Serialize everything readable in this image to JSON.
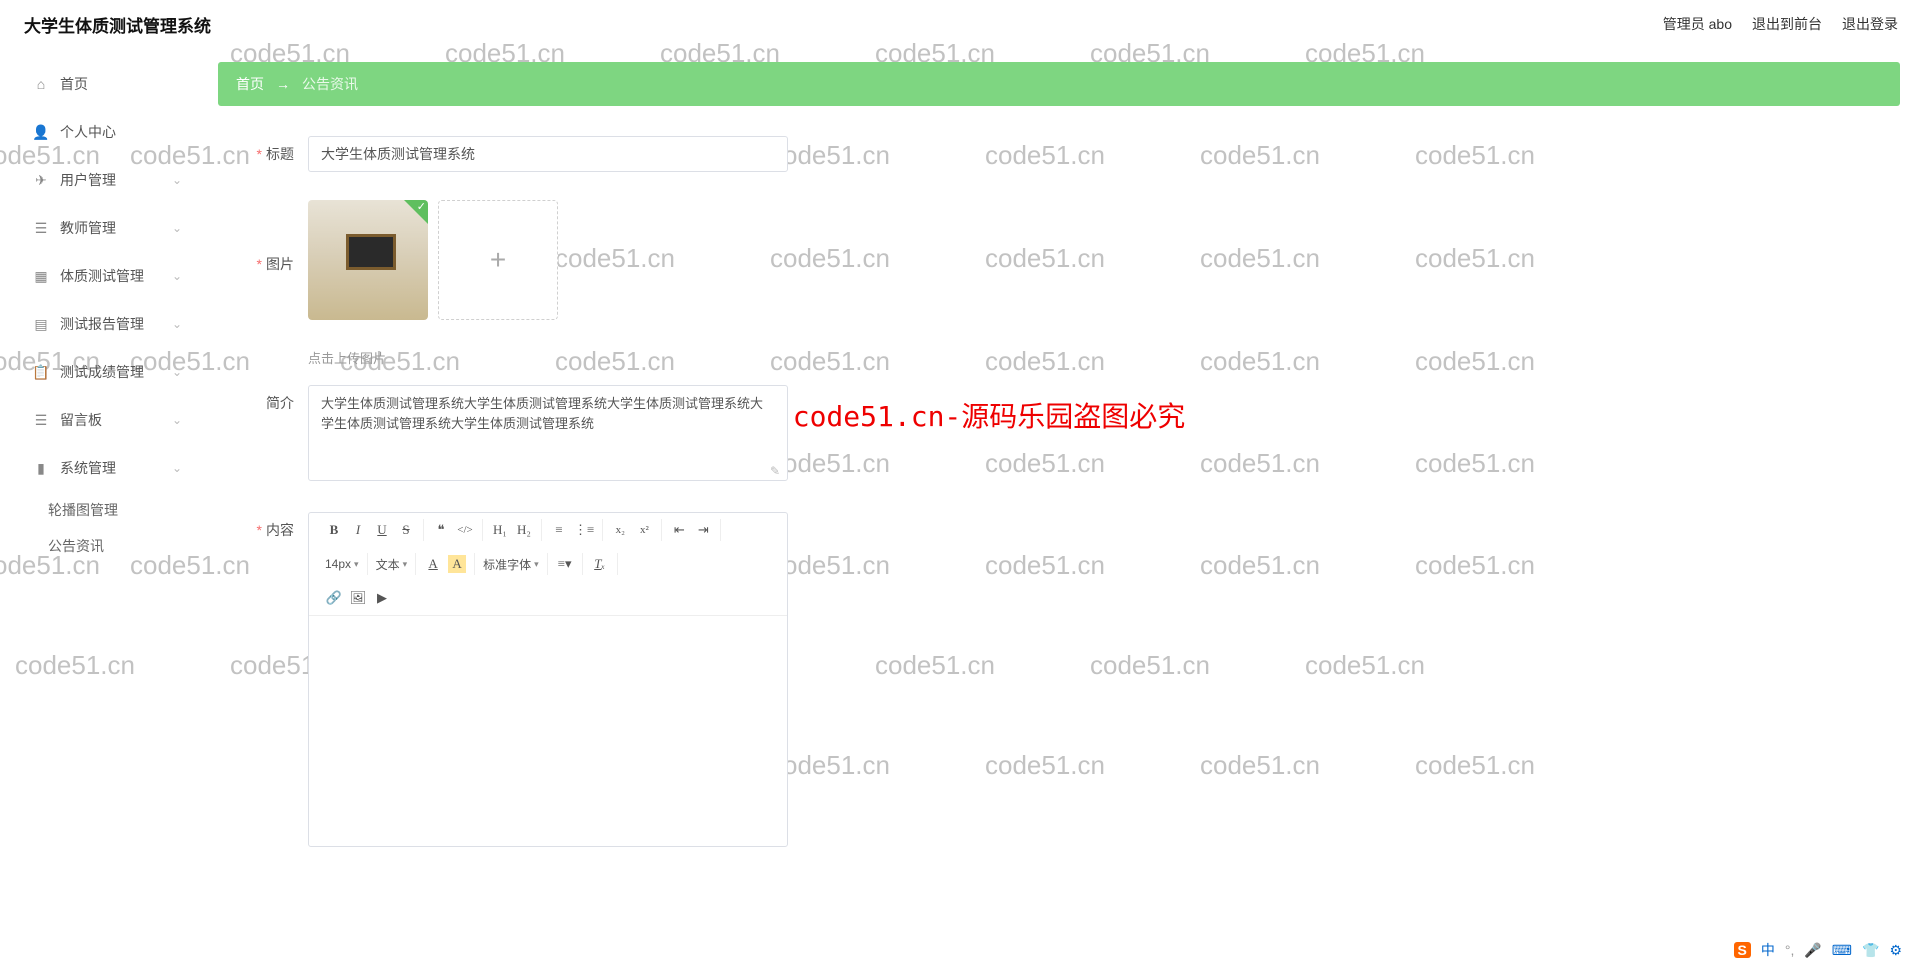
{
  "header": {
    "title": "大学生体质测试管理系统",
    "user_label": "管理员 abo",
    "logout_front": "退出到前台",
    "logout": "退出登录"
  },
  "sidebar": {
    "items": [
      {
        "icon": "home-icon",
        "label": "首页",
        "expandable": false
      },
      {
        "icon": "user-icon",
        "label": "个人中心",
        "expandable": false
      },
      {
        "icon": "send-icon",
        "label": "用户管理",
        "expandable": true
      },
      {
        "icon": "list-icon",
        "label": "教师管理",
        "expandable": true
      },
      {
        "icon": "grid-icon",
        "label": "体质测试管理",
        "expandable": true
      },
      {
        "icon": "doc-icon",
        "label": "测试报告管理",
        "expandable": true
      },
      {
        "icon": "clipboard-icon",
        "label": "测试成绩管理",
        "expandable": true
      },
      {
        "icon": "list-icon",
        "label": "留言板",
        "expandable": true
      },
      {
        "icon": "bar-icon",
        "label": "系统管理",
        "expandable": true
      }
    ],
    "submenus": {
      "system": [
        {
          "label": "轮播图管理"
        },
        {
          "label": "公告资讯"
        }
      ]
    }
  },
  "breadcrumb": {
    "home": "首页",
    "arrow": "→",
    "current": "公告资讯"
  },
  "form": {
    "title_label": "标题",
    "title_value": "大学生体质测试管理系统",
    "image_label": "图片",
    "upload_hint": "点击上传图片",
    "summary_label": "简介",
    "summary_value": "大学生体质测试管理系统大学生体质测试管理系统大学生体质测试管理系统大学生体质测试管理系统大学生体质测试管理系统",
    "content_label": "内容"
  },
  "editor_toolbar": {
    "font_size": "14px",
    "text_mode": "文本",
    "font_family": "标准字体"
  },
  "watermark": {
    "text": "code51.cn",
    "red_text": "code51.cn-源码乐园盗图必究"
  },
  "ime": {
    "s_badge": "S",
    "lang": "中"
  }
}
